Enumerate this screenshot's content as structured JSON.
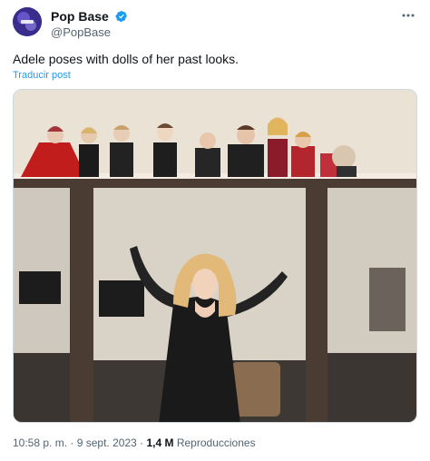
{
  "post": {
    "author": {
      "display_name": "Pop Base",
      "handle": "@PopBase",
      "verified": true,
      "avatar_icon": "avatar-image"
    },
    "text": "Adele poses with dolls of her past looks.",
    "translate_label": "Traducir post",
    "more_icon": "ellipsis-icon",
    "media": {
      "type": "photo"
    },
    "time": "10:58 p. m.",
    "separator": "·",
    "date": "9 sept. 2023",
    "views_count": "1,4 M",
    "views_label": "Reproducciones"
  },
  "colors": {
    "text": "#0f1419",
    "secondary": "#536471",
    "link": "#1d9bf0",
    "verified": "#1d9bf0"
  }
}
